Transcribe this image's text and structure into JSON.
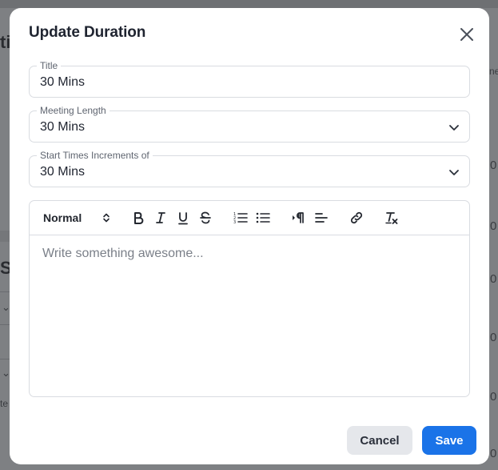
{
  "background": {
    "fragments": [
      "ti",
      "S",
      "ne",
      "0",
      "0",
      "0",
      "0",
      "0",
      "0",
      "te"
    ]
  },
  "modal": {
    "title": "Update Duration",
    "close_icon": "close-icon"
  },
  "fields": {
    "title": {
      "label": "Title",
      "value": "30 Mins"
    },
    "meeting_length": {
      "label": "Meeting Length",
      "value": "30 Mins"
    },
    "start_increments": {
      "label": "Start Times Increments of",
      "value": "30 Mins"
    }
  },
  "editor": {
    "format_select": "Normal",
    "placeholder": "Write something awesome...",
    "toolbar_icons": [
      "bold-icon",
      "italic-icon",
      "underline-icon",
      "strikethrough-icon",
      "ordered-list-icon",
      "bullet-list-icon",
      "text-direction-icon",
      "align-icon",
      "link-icon",
      "clear-format-icon"
    ]
  },
  "actions": {
    "cancel": "Cancel",
    "save": "Save"
  },
  "colors": {
    "primary": "#1a73e8",
    "cancel_bg": "#e5e7eb",
    "overlay": "#7e8083"
  }
}
